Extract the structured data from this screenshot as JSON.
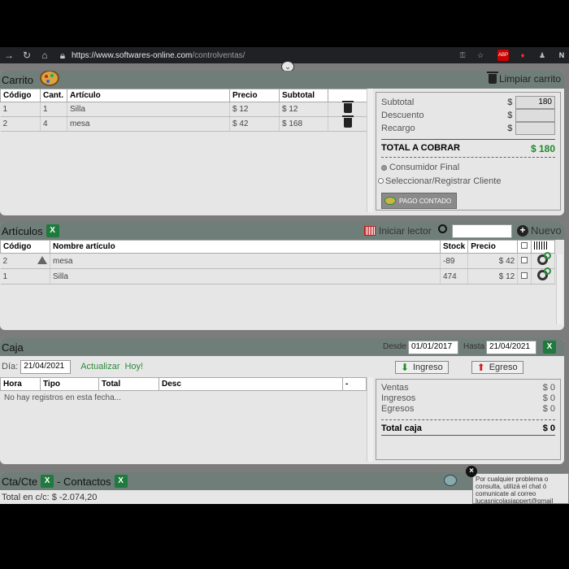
{
  "browser": {
    "url_main": "https://www.softwares-online.com",
    "url_path": "/controlventas/",
    "back_icon": "back-arrow-icon",
    "reload_icon": "reload-icon",
    "home_icon": "home-icon"
  },
  "carrito": {
    "title": "Carrito",
    "clear_label": "Limpiar carrito",
    "headers": [
      "Código",
      "Cant.",
      "Artículo",
      "Precio",
      "Subtotal",
      ""
    ],
    "rows": [
      {
        "codigo": "1",
        "cant": "1",
        "articulo": "Silla",
        "precio": "$ 12",
        "subtotal": "$ 12"
      },
      {
        "codigo": "2",
        "cant": "4",
        "articulo": "mesa",
        "precio": "$ 42",
        "subtotal": "$ 168"
      }
    ],
    "summary": {
      "subtotal_label": "Subtotal",
      "subtotal_currency": "$",
      "subtotal_value": "180",
      "descuento_label": "Descuento",
      "descuento_currency": "$",
      "recargo_label": "Recargo",
      "recargo_currency": "$",
      "total_label": "TOTAL A COBRAR",
      "total_value": "$ 180",
      "radio_1": "Consumidor Final",
      "radio_2": "Seleccionar/Registrar Cliente",
      "pago_label": "PAGO CONTADO"
    }
  },
  "articulos": {
    "title": "Artículos",
    "xls": "X",
    "lector_label": "Iniciar lector",
    "nuevo_label": "Nuevo",
    "headers": [
      "Código",
      "Nombre artículo",
      "Stock",
      "Precio"
    ],
    "rows": [
      {
        "codigo": "2",
        "nombre": "mesa",
        "stock": "-89",
        "precio": "$ 42"
      },
      {
        "codigo": "1",
        "nombre": "Silla",
        "stock": "474",
        "precio": "$ 12"
      }
    ]
  },
  "caja": {
    "title": "Caja",
    "desde_label": "Desde",
    "desde_value": "01/01/2017",
    "hasta_label": "Hasta",
    "hasta_value": "21/04/2021",
    "dia_label": "Día:",
    "dia_value": "21/04/2021",
    "actualizar_label": "Actualizar",
    "hoy_label": "Hoy!",
    "headers": [
      "Hora",
      "Tipo",
      "Total",
      "Desc",
      "-"
    ],
    "empty_text": "No hay registros en esta fecha...",
    "ingreso_label": "Ingreso",
    "egreso_label": "Egreso",
    "ventas_label": "Ventas",
    "ventas_value": "$ 0",
    "ingresos_label": "Ingresos",
    "ingresos_value": "$ 0",
    "egresos_label": "Egresos",
    "egresos_value": "$ 0",
    "total_caja_label": "Total caja",
    "total_caja_value": "$ 0"
  },
  "cta": {
    "title": "Cta/Cte",
    "contactos": "- Contactos",
    "total_text": "Total en c/c: $ -2.074,20"
  },
  "chat": {
    "text_1": "Por cualquier problema o",
    "text_2": "consulta, utilizá el chat ó",
    "text_3": "comunicate al correo",
    "text_4": "lucasnicolasiappert@gmail"
  }
}
